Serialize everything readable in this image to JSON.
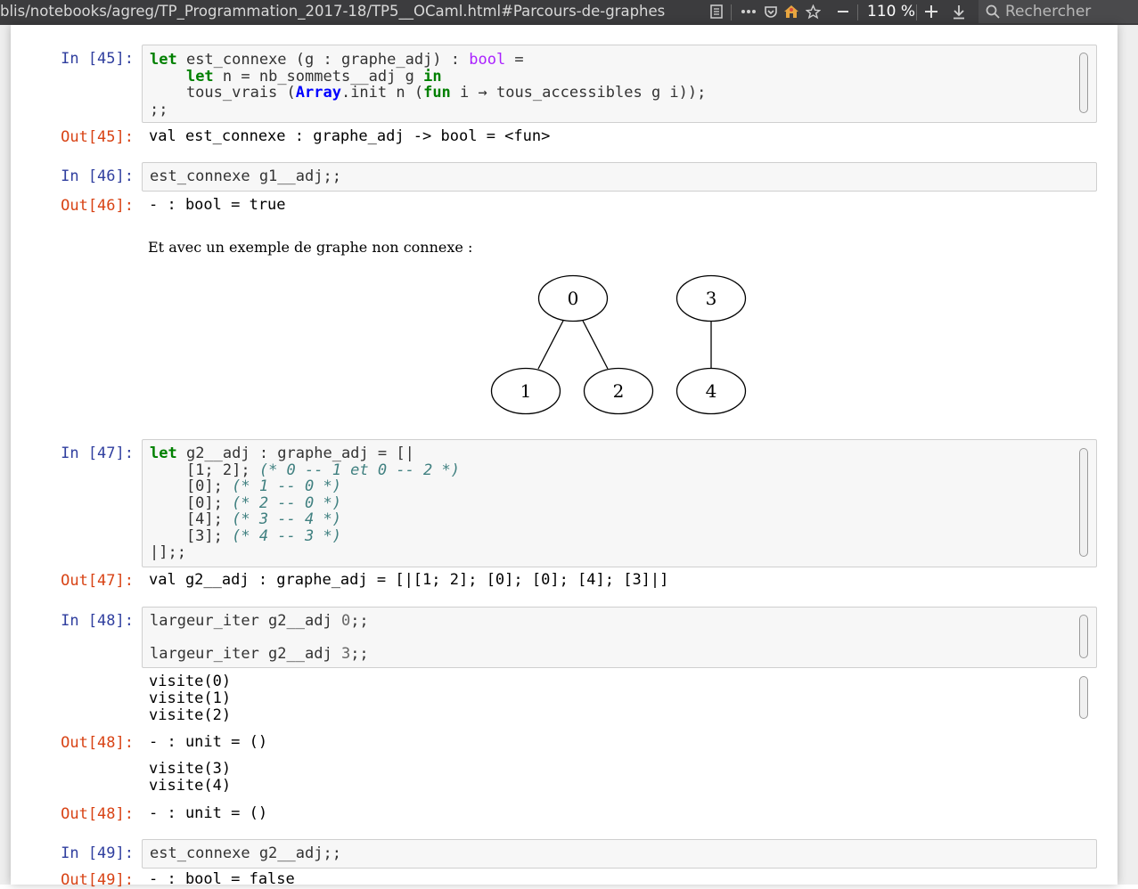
{
  "browser": {
    "url": "blis/notebooks/agreg/TP_Programmation_2017-18/TP5__OCaml.html#Parcours-de-graphes",
    "zoom": "110 %",
    "search_placeholder": "Rechercher",
    "icons": [
      "reader-view-icon",
      "more-icon",
      "pocket-icon",
      "home-icon",
      "bookmark-star-icon",
      "zoom-out-icon",
      "zoom-in-icon",
      "download-icon",
      "search-icon"
    ]
  },
  "cells": {
    "c45": {
      "in_prompt": "In [45]:",
      "line1": {
        "kw": "let",
        "a": " est_connexe (g : graphe_adj) : ",
        "ty": "bool",
        "b": " ="
      },
      "line2": {
        "pre": "    ",
        "kw": "let",
        "a": " n = nb_sommets__adj g ",
        "kw2": "in"
      },
      "line3": {
        "a": "    tous_vrais (",
        "mod": "Array",
        "b": ".init n (",
        "kw": "fun",
        "c": " i → tous_accessibles g i));"
      },
      "line4": ";;",
      "out_prompt": "Out[45]:",
      "output": "val est_connexe : graphe_adj -> bool = <fun>"
    },
    "c46": {
      "in_prompt": "In [46]:",
      "code": "est_connexe g1__adj;;",
      "out_prompt": "Out[46]:",
      "output": "- : bool = true"
    },
    "markdown": "Et avec un exemple de graphe non connexe :",
    "graph": {
      "nodes": [
        "0",
        "1",
        "2",
        "3",
        "4"
      ],
      "edges": [
        [
          "0",
          "1"
        ],
        [
          "0",
          "2"
        ],
        [
          "3",
          "4"
        ]
      ]
    },
    "c47": {
      "in_prompt": "In [47]:",
      "line1": {
        "kw": "let",
        "a": " g2__adj : graphe_adj = [|"
      },
      "rows": [
        {
          "code": "    [1; 2]; ",
          "comment": "(* 0 -- 1 et 0 -- 2 *)"
        },
        {
          "code": "    [0]; ",
          "comment": "(* 1 -- 0 *)"
        },
        {
          "code": "    [0]; ",
          "comment": "(* 2 -- 0 *)"
        },
        {
          "code": "    [4]; ",
          "comment": "(* 3 -- 4 *)"
        },
        {
          "code": "    [3]; ",
          "comment": "(* 4 -- 3 *)"
        }
      ],
      "last": "|];;",
      "out_prompt": "Out[47]:",
      "output": "val g2__adj : graphe_adj = [|[1; 2]; [0]; [0]; [4]; [3]|]"
    },
    "c48": {
      "in_prompt": "In [48]:",
      "line1": {
        "a": "largeur_iter g2__adj ",
        "n": "0",
        "b": ";;"
      },
      "line2": {
        "a": "largeur_iter g2__adj ",
        "n": "3",
        "b": ";;"
      },
      "stdout1": "visite(0)\nvisite(1)\nvisite(2)",
      "out_prompt_a": "Out[48]:",
      "output_a": "- : unit = ()",
      "stdout2": "visite(3)\nvisite(4)",
      "out_prompt_b": "Out[48]:",
      "output_b": "- : unit = ()"
    },
    "c49": {
      "in_prompt": "In [49]:",
      "code": "est_connexe g2__adj;;",
      "out_prompt": "Out[49]:",
      "output": "- : bool = false"
    }
  }
}
